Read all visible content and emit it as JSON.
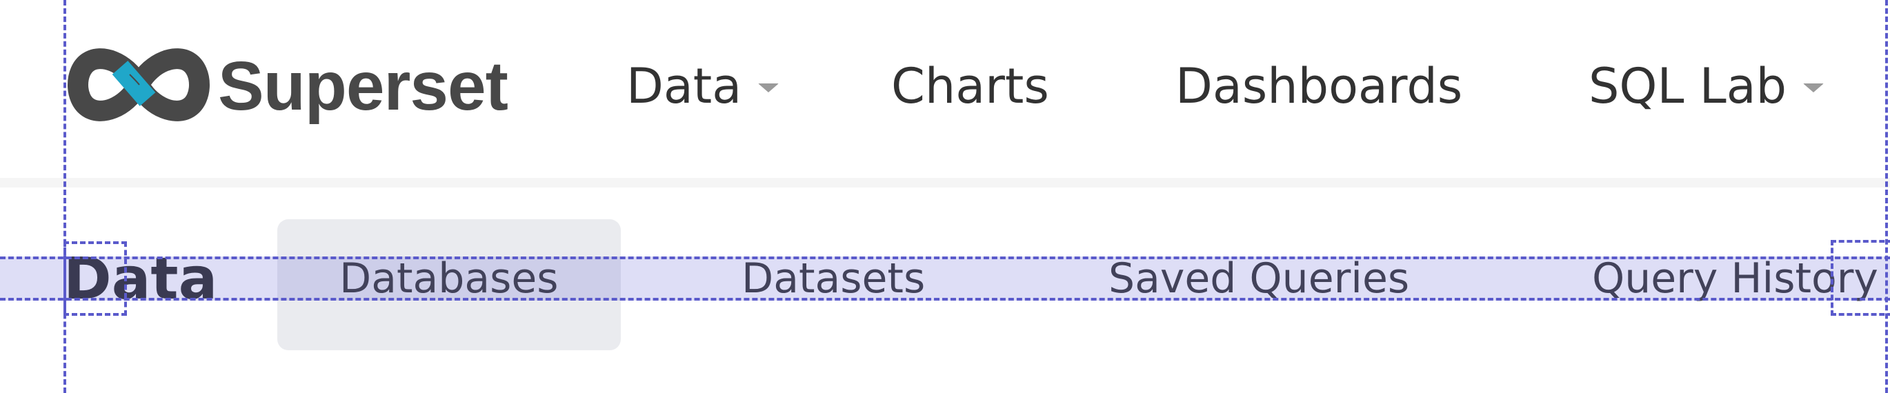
{
  "brand": {
    "name": "Superset",
    "logo_icon": "superset-infinity-logo",
    "logo_colors": {
      "dark": "#484848",
      "accent": "#20a7c9"
    }
  },
  "nav": {
    "items": [
      {
        "label": "Data",
        "has_dropdown": true
      },
      {
        "label": "Charts",
        "has_dropdown": false
      },
      {
        "label": "Dashboards",
        "has_dropdown": false
      },
      {
        "label": "SQL Lab",
        "has_dropdown": true
      }
    ]
  },
  "subheader": {
    "title": "Data",
    "tabs": [
      {
        "label": "Databases",
        "active": true
      },
      {
        "label": "Datasets",
        "active": false
      },
      {
        "label": "Saved Queries",
        "active": false
      },
      {
        "label": "Query History",
        "active": false
      }
    ]
  },
  "colors": {
    "text": "#323232",
    "active_tab_bg": "#eaebef",
    "overlay_guide": "#5a5acb"
  }
}
